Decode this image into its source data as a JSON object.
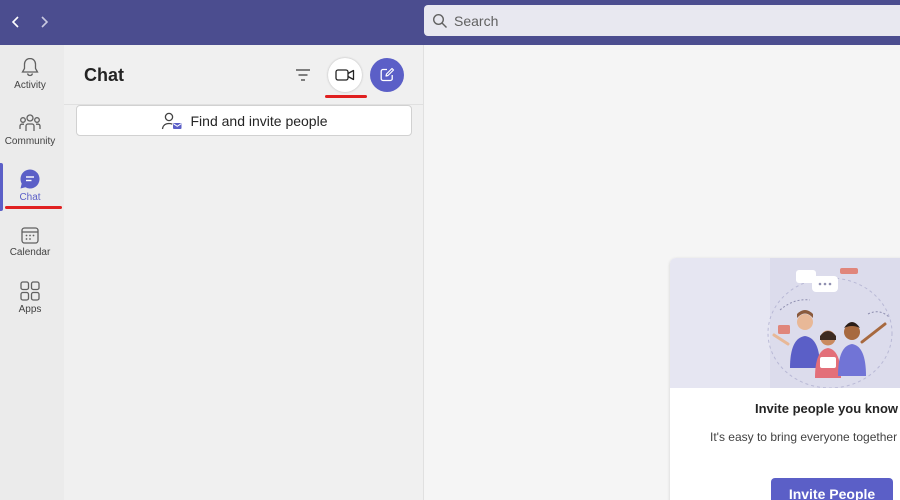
{
  "topbar": {
    "back_icon": "chevron-left-icon",
    "forward_icon": "chevron-right-icon",
    "search": {
      "icon": "search-icon",
      "placeholder": "Search"
    }
  },
  "rail": {
    "items": [
      {
        "label": "Activity",
        "icon": "bell-icon"
      },
      {
        "label": "Community",
        "icon": "people-group-icon"
      },
      {
        "label": "Chat",
        "icon": "chat-bubble-icon",
        "active": true
      },
      {
        "label": "Calendar",
        "icon": "calendar-icon"
      },
      {
        "label": "Apps",
        "icon": "apps-grid-icon"
      }
    ]
  },
  "chat_pane": {
    "title": "Chat",
    "filter_icon": "filter-icon",
    "meet_icon": "video-camera-icon",
    "new_chat_icon": "compose-icon",
    "invite_label": "Find and invite people"
  },
  "main": {
    "card": {
      "title": "Invite people you know",
      "description": "It's easy to bring everyone together",
      "button_label": "Invite People"
    }
  },
  "colors": {
    "topbar": "#4b4d8f",
    "accent": "#5b5fc7",
    "highlight_underline": "#e02020"
  }
}
